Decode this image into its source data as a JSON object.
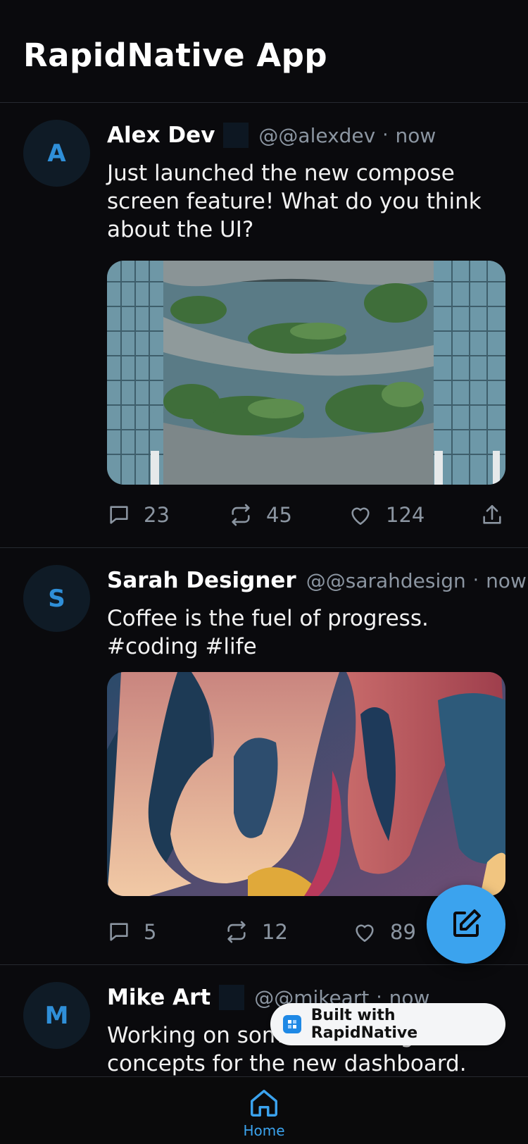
{
  "app": {
    "title": "RapidNative App"
  },
  "posts": [
    {
      "avatar_letter": "A",
      "author": "Alex Dev",
      "handle": "@@alexdev",
      "time": "now",
      "text": "Just launched the new compose screen feature! What do you think about the UI?",
      "image": "photo of a glass building with terraced tropical gardens",
      "stats": {
        "replies": "23",
        "retweets": "45",
        "likes": "124"
      }
    },
    {
      "avatar_letter": "S",
      "author": "Sarah Designer",
      "handle": "@@sarahdesign",
      "time": "now",
      "text": "Coffee is the fuel of progress. #coding #life",
      "image": "abstract 3D render of flowing colorful shapes",
      "stats": {
        "replies": "5",
        "retweets": "12",
        "likes": "89"
      }
    },
    {
      "avatar_letter": "M",
      "author": "Mike Art",
      "handle": "@@mikeart",
      "time": "now",
      "text": "Working on some new design concepts for the new dashboard. Love these"
    }
  ],
  "badge": {
    "label": "Built with RapidNative"
  },
  "tabbar": {
    "home_label": "Home"
  },
  "colors": {
    "accent": "#3ba3ee",
    "background": "#0a0a0d",
    "muted": "#8b95a1",
    "avatar_bg": "#0f1b26",
    "avatar_letter": "#2f8fd8"
  },
  "icons": [
    "reply-icon",
    "retweet-icon",
    "like-icon",
    "share-icon",
    "compose-icon",
    "home-icon",
    "rapidnative-logo-icon"
  ]
}
